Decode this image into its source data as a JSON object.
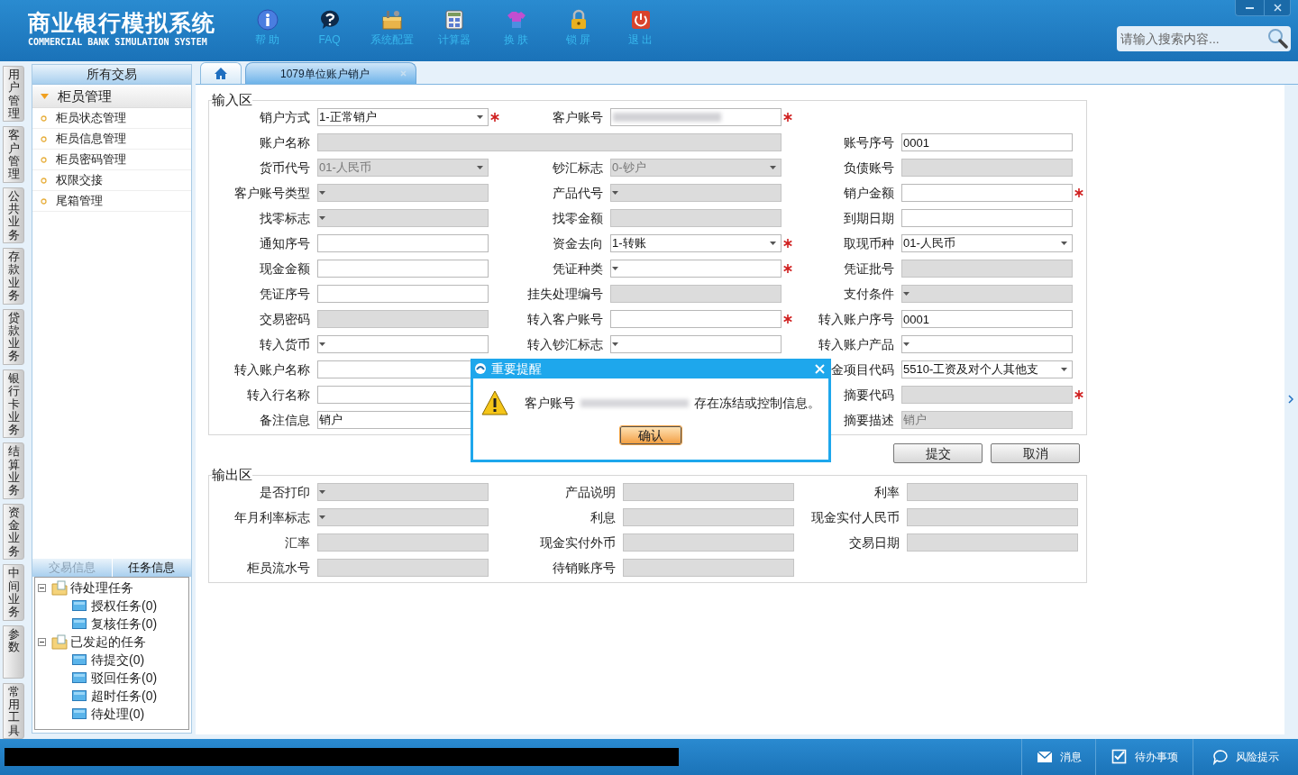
{
  "header": {
    "title": "商业银行模拟系统",
    "subtitle": "COMMERCIAL BANK SIMULATION SYSTEM",
    "toolbar": [
      {
        "label": "帮 助",
        "kind": "info"
      },
      {
        "label": "FAQ",
        "kind": "faq"
      },
      {
        "label": "系统配置",
        "kind": "config"
      },
      {
        "label": "计算器",
        "kind": "calculator"
      },
      {
        "label": "换 肤",
        "kind": "skin"
      },
      {
        "label": "锁 屏",
        "kind": "lock"
      },
      {
        "label": "退 出",
        "kind": "exit"
      }
    ],
    "search": {
      "placeholder": "请输入搜索内容..."
    }
  },
  "side_tabs": [
    "用户管理",
    "客户管理",
    "公共业务",
    "存款业务",
    "贷款业务",
    "银行卡业务",
    "结算业务",
    "资金业务",
    "中间业务",
    "参数",
    "常用工具"
  ],
  "nav": {
    "title": "所有交易",
    "group": {
      "label": "柜员管理",
      "expanded": true,
      "items": [
        "柜员状态管理",
        "柜员信息管理",
        "柜员密码管理",
        "权限交接",
        "尾箱管理"
      ]
    }
  },
  "task_panel": {
    "tabs": [
      {
        "label": "交易信息",
        "selected": false
      },
      {
        "label": "任务信息",
        "selected": true
      }
    ],
    "tree": [
      {
        "label": "待处理任务",
        "expanded": true,
        "children": [
          {
            "label": "授权任务(0)"
          },
          {
            "label": "复核任务(0)"
          }
        ]
      },
      {
        "label": "已发起的任务",
        "expanded": true,
        "children": [
          {
            "label": "待提交(0)"
          },
          {
            "label": "驳回任务(0)"
          },
          {
            "label": "超时任务(0)"
          },
          {
            "label": "待处理(0)"
          }
        ]
      }
    ]
  },
  "page_tabs": [
    {
      "kind": "home",
      "selected": false
    },
    {
      "kind": "page",
      "label": "1079单位账户销户",
      "selected": true
    }
  ],
  "input_section": {
    "title": "输入区",
    "rows": [
      [
        {
          "label": "销户方式",
          "kind": "select",
          "value": "1-正常销户",
          "disabled": false,
          "required": true
        },
        {
          "label": "客户账号",
          "kind": "text",
          "redacted": true,
          "disabled": false,
          "required": true
        }
      ],
      [
        {
          "label": "账户名称",
          "kind": "wide",
          "disabled": true,
          "required": false
        },
        null,
        {
          "label": "账号序号",
          "kind": "text",
          "value": "0001",
          "disabled": false,
          "required": false
        }
      ],
      [
        {
          "label": "货币代号",
          "kind": "select",
          "value": "01-人民币",
          "disabled": true,
          "required": false
        },
        {
          "label": "钞汇标志",
          "kind": "select",
          "value": "0-钞户",
          "disabled": true,
          "required": false
        },
        {
          "label": "负债账号",
          "kind": "text",
          "disabled": true,
          "required": false
        }
      ],
      [
        {
          "label": "客户账号类型",
          "kind": "select",
          "disabled": true,
          "required": false
        },
        {
          "label": "产品代号",
          "kind": "select",
          "disabled": true,
          "required": false
        },
        {
          "label": "销户金额",
          "kind": "text",
          "disabled": false,
          "required": true
        }
      ],
      [
        {
          "label": "找零标志",
          "kind": "select",
          "disabled": true,
          "required": false
        },
        {
          "label": "找零金额",
          "kind": "text",
          "disabled": true,
          "required": false
        },
        {
          "label": "到期日期",
          "kind": "text",
          "disabled": false,
          "required": false
        }
      ],
      [
        {
          "label": "通知序号",
          "kind": "text",
          "disabled": false,
          "required": false
        },
        {
          "label": "资金去向",
          "kind": "select",
          "value": "1-转账",
          "disabled": false,
          "required": true
        },
        {
          "label": "取现币种",
          "kind": "select",
          "value": "01-人民币",
          "disabled": false,
          "required": false
        }
      ],
      [
        {
          "label": "现金金额",
          "kind": "text",
          "disabled": false,
          "required": false
        },
        {
          "label": "凭证种类",
          "kind": "select",
          "disabled": false,
          "required": true
        },
        {
          "label": "凭证批号",
          "kind": "text",
          "disabled": true,
          "required": false
        }
      ],
      [
        {
          "label": "凭证序号",
          "kind": "text",
          "disabled": false,
          "required": false
        },
        {
          "label": "挂失处理编号",
          "kind": "text",
          "disabled": true,
          "required": false
        },
        {
          "label": "支付条件",
          "kind": "select",
          "disabled": true,
          "required": false
        }
      ],
      [
        {
          "label": "交易密码",
          "kind": "text",
          "disabled": true,
          "required": false
        },
        {
          "label": "转入客户账号",
          "kind": "text",
          "disabled": false,
          "required": true
        },
        {
          "label": "转入账户序号",
          "kind": "text",
          "value": "0001",
          "disabled": false,
          "required": false
        }
      ],
      [
        {
          "label": "转入货币",
          "kind": "select",
          "disabled": false,
          "required": false
        },
        {
          "label": "转入钞汇标志",
          "kind": "select",
          "disabled": false,
          "required": false
        },
        {
          "label": "转入账户产品",
          "kind": "select",
          "disabled": false,
          "required": false
        }
      ],
      [
        {
          "label": "转入账户名称",
          "kind": "text",
          "disabled": false,
          "required": false
        },
        null,
        {
          "label": "金项目代码",
          "kind": "select",
          "value": "5510-工资及对个人其他支",
          "disabled": false,
          "required": false
        }
      ],
      [
        {
          "label": "转入行名称",
          "kind": "text",
          "disabled": false,
          "required": false
        },
        null,
        {
          "label": "摘要代码",
          "kind": "text",
          "disabled": true,
          "required": true
        }
      ],
      [
        {
          "label": "备注信息",
          "kind": "text",
          "value": "销户",
          "disabled": false,
          "required": false
        },
        null,
        {
          "label": "摘要描述",
          "kind": "text",
          "value": "销户",
          "disabled": true,
          "required": false
        }
      ]
    ]
  },
  "buttons": [
    "提交",
    "取消"
  ],
  "output_section": {
    "title": "输出区",
    "rows": [
      [
        {
          "label": "是否打印",
          "kind": "select",
          "disabled": true
        },
        {
          "label": "产品说明",
          "kind": "text",
          "disabled": true
        },
        {
          "label": "利率",
          "kind": "text",
          "disabled": true
        }
      ],
      [
        {
          "label": "年月利率标志",
          "kind": "select",
          "disabled": true
        },
        {
          "label": "利息",
          "kind": "text",
          "disabled": true
        },
        {
          "label": "现金实付人民币",
          "kind": "text",
          "disabled": true
        }
      ],
      [
        {
          "label": "汇率",
          "kind": "text",
          "disabled": true
        },
        {
          "label": "现金实付外币",
          "kind": "text",
          "disabled": true
        },
        {
          "label": "交易日期",
          "kind": "text",
          "disabled": true
        }
      ],
      [
        {
          "label": "柜员流水号",
          "kind": "text",
          "disabled": true
        },
        {
          "label": "待销账序号",
          "kind": "text",
          "disabled": true
        }
      ]
    ]
  },
  "dialog": {
    "title": "重要提醒",
    "message_before": "客户账号",
    "redacted": true,
    "message_after": "存在冻结或控制信息。",
    "button": "确认"
  },
  "status_bar": {
    "items": [
      {
        "label": "消息",
        "kind": "message"
      },
      {
        "label": "待办事项",
        "kind": "todo"
      },
      {
        "label": "风险提示",
        "kind": "risk"
      }
    ]
  }
}
